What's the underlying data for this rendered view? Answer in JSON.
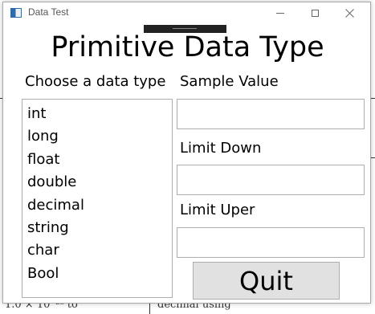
{
  "background": {
    "left_text": "1.0 × 10⁻²⁸ to",
    "right_text": "decimal using"
  },
  "window": {
    "title": "Data Test",
    "controls": {
      "minimize": "minimize",
      "maximize": "maximize",
      "close": "close"
    }
  },
  "main": {
    "heading": "Primitive Data Type",
    "choose_label": "Choose a data type",
    "sample_label": "Sample Value",
    "limit_down_label": "Limit Down",
    "limit_uper_label": "Limit Uper",
    "quit_label": "Quit",
    "data_types": [
      "int",
      "long",
      "float",
      "double",
      "decimal",
      "string",
      "char",
      "Bool"
    ],
    "sample_value": "",
    "limit_down_value": "",
    "limit_uper_value": ""
  }
}
